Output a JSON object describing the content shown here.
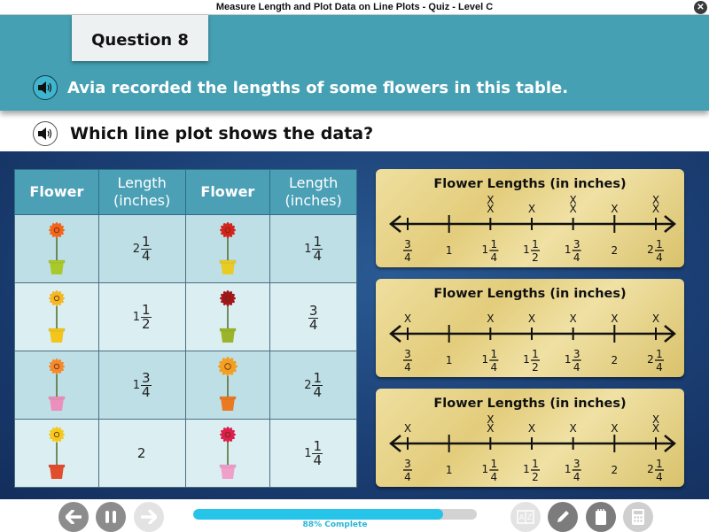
{
  "window": {
    "title": "Measure Length and Plot Data on Line Plots - Quiz - Level C",
    "close_icon": "close-x-icon"
  },
  "question": {
    "label": "Question 8",
    "prompt": "Avia recorded the lengths of some flowers in this table.",
    "ask": "Which line plot shows the data?"
  },
  "table": {
    "headers": [
      "Flower",
      "Length (inches)",
      "Flower",
      "Length (inches)"
    ],
    "rows": [
      [
        {
          "flower": "orange flower in green pot",
          "petal": "#f2661c",
          "pot": "#a9c92a",
          "length": {
            "whole": "2",
            "num": "1",
            "den": "4"
          }
        },
        {
          "flower": "red flower in yellow pot",
          "petal": "#d5231c",
          "pot": "#e9cc23",
          "length": {
            "whole": "1",
            "num": "1",
            "den": "4"
          }
        }
      ],
      [
        {
          "flower": "yellow flower in yellow pot",
          "petal": "#f3b823",
          "pot": "#f2c61a",
          "length": {
            "whole": "1",
            "num": "1",
            "den": "2"
          }
        },
        {
          "flower": "dark red flower in green pot",
          "petal": "#a3161a",
          "pot": "#9ab52a",
          "length": {
            "whole": "",
            "num": "3",
            "den": "4"
          }
        }
      ],
      [
        {
          "flower": "orange flower in pink pot",
          "petal": "#f48a2a",
          "pot": "#ec8fbd",
          "length": {
            "whole": "1",
            "num": "3",
            "den": "4"
          }
        },
        {
          "flower": "orange-yellow flower in orange pot",
          "petal": "#f2a021",
          "pot": "#ea7a21",
          "length": {
            "whole": "2",
            "num": "1",
            "den": "4"
          }
        }
      ],
      [
        {
          "flower": "yellow flower in striped pot",
          "petal": "#f5c91c",
          "pot": "#e24d2e",
          "length": {
            "whole": "2",
            "num": "",
            "den": ""
          }
        },
        {
          "flower": "pink flower in pink pot",
          "petal": "#dc1f4c",
          "pot": "#ef9fca",
          "length": {
            "whole": "1",
            "num": "1",
            "den": "4"
          }
        }
      ]
    ]
  },
  "chart_data": [
    {
      "type": "scatter",
      "title": "Flower Lengths (in inches)",
      "option": "A",
      "x_ticks": [
        0.75,
        1,
        1.25,
        1.5,
        1.75,
        2,
        2.25
      ],
      "tick_labels": [
        {
          "whole": "",
          "num": "3",
          "den": "4"
        },
        {
          "whole": "1",
          "num": "",
          "den": ""
        },
        {
          "whole": "1",
          "num": "1",
          "den": "4"
        },
        {
          "whole": "1",
          "num": "1",
          "den": "2"
        },
        {
          "whole": "1",
          "num": "3",
          "den": "4"
        },
        {
          "whole": "2",
          "num": "",
          "den": ""
        },
        {
          "whole": "2",
          "num": "1",
          "den": "4"
        }
      ],
      "marker": "X",
      "counts": [
        0,
        0,
        2,
        1,
        2,
        1,
        2
      ],
      "xlim": [
        0.75,
        2.25
      ]
    },
    {
      "type": "scatter",
      "title": "Flower Lengths (in inches)",
      "option": "B",
      "x_ticks": [
        0.75,
        1,
        1.25,
        1.5,
        1.75,
        2,
        2.25
      ],
      "tick_labels": [
        {
          "whole": "",
          "num": "3",
          "den": "4"
        },
        {
          "whole": "1",
          "num": "",
          "den": ""
        },
        {
          "whole": "1",
          "num": "1",
          "den": "4"
        },
        {
          "whole": "1",
          "num": "1",
          "den": "2"
        },
        {
          "whole": "1",
          "num": "3",
          "den": "4"
        },
        {
          "whole": "2",
          "num": "",
          "den": ""
        },
        {
          "whole": "2",
          "num": "1",
          "den": "4"
        }
      ],
      "marker": "X",
      "counts": [
        1,
        0,
        1,
        1,
        1,
        1,
        1
      ],
      "xlim": [
        0.75,
        2.25
      ]
    },
    {
      "type": "scatter",
      "title": "Flower Lengths (in inches)",
      "option": "C",
      "x_ticks": [
        0.75,
        1,
        1.25,
        1.5,
        1.75,
        2,
        2.25
      ],
      "tick_labels": [
        {
          "whole": "",
          "num": "3",
          "den": "4"
        },
        {
          "whole": "1",
          "num": "",
          "den": ""
        },
        {
          "whole": "1",
          "num": "1",
          "den": "4"
        },
        {
          "whole": "1",
          "num": "1",
          "den": "2"
        },
        {
          "whole": "1",
          "num": "3",
          "den": "4"
        },
        {
          "whole": "2",
          "num": "",
          "den": ""
        },
        {
          "whole": "2",
          "num": "1",
          "den": "4"
        }
      ],
      "marker": "X",
      "counts": [
        1,
        0,
        2,
        1,
        1,
        1,
        2
      ],
      "xlim": [
        0.75,
        2.25
      ]
    }
  ],
  "footer": {
    "back_icon": "arrow-left-icon",
    "pause_icon": "pause-icon",
    "forward_icon": "arrow-right-icon",
    "progress_percent": 88,
    "progress_label": "88% Complete",
    "glossary_icon": "glossary-az-icon",
    "pencil_icon": "pencil-icon",
    "notepad_icon": "notepad-icon",
    "calculator_icon": "calculator-icon"
  },
  "colors": {
    "banner": "#45a0b3",
    "table_header": "#4ba0b6",
    "progress": "#27c4ea",
    "stage": "#1b3f74",
    "card": "#e8d58c"
  }
}
